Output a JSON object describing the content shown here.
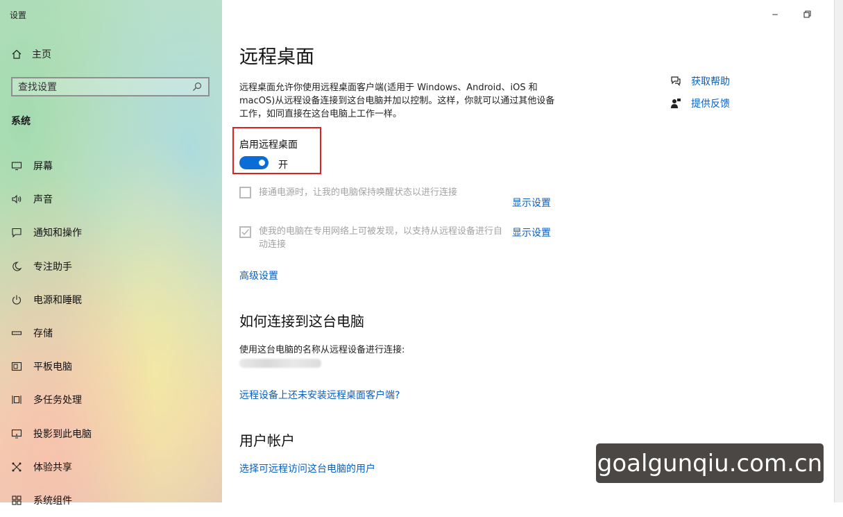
{
  "window": {
    "title": "设置"
  },
  "sidebar": {
    "home_label": "主页",
    "search_placeholder": "查找设置",
    "section_title": "系统",
    "items": [
      {
        "icon": "monitor-icon",
        "label": "屏幕"
      },
      {
        "icon": "sound-icon",
        "label": "声音"
      },
      {
        "icon": "notification-icon",
        "label": "通知和操作"
      },
      {
        "icon": "moon-icon",
        "label": "专注助手"
      },
      {
        "icon": "power-icon",
        "label": "电源和睡眠"
      },
      {
        "icon": "storage-icon",
        "label": "存储"
      },
      {
        "icon": "tablet-icon",
        "label": "平板电脑"
      },
      {
        "icon": "multitask-icon",
        "label": "多任务处理"
      },
      {
        "icon": "project-icon",
        "label": "投影到此电脑"
      },
      {
        "icon": "share-icon",
        "label": "体验共享"
      },
      {
        "icon": "components-icon",
        "label": "系统组件"
      }
    ]
  },
  "main": {
    "title": "远程桌面",
    "description": "远程桌面允许你使用远程桌面客户端(适用于 Windows、Android、iOS 和 macOS)从远程设备连接到这台电脑并加以控制。这样，你就可以通过其他设备工作，如同直接在这台电脑上工作一样。",
    "toggle": {
      "label": "启用远程桌面",
      "state_text": "开",
      "on": true
    },
    "options": [
      {
        "text": "接通电源时，让我的电脑保持唤醒状态以进行连接",
        "checked": false,
        "link": "显示设置"
      },
      {
        "text": "使我的电脑在专用网络上可被发现，以支持从远程设备进行自动连接",
        "checked": true,
        "link": "显示设置"
      }
    ],
    "advanced_link": "高级设置",
    "connect_section": {
      "heading": "如何连接到这台电脑",
      "text": "使用这台电脑的名称从远程设备进行连接:",
      "link": "远程设备上还未安装远程桌面客户端?"
    },
    "accounts_section": {
      "heading": "用户帐户",
      "link": "选择可远程访问这台电脑的用户"
    }
  },
  "help": {
    "get_help": "获取帮助",
    "feedback": "提供反馈"
  },
  "watermark": "goalgunqiu.com.cn",
  "colors": {
    "accent": "#0a6cd6",
    "link": "#0a5fc0",
    "highlight": "#e02020"
  }
}
